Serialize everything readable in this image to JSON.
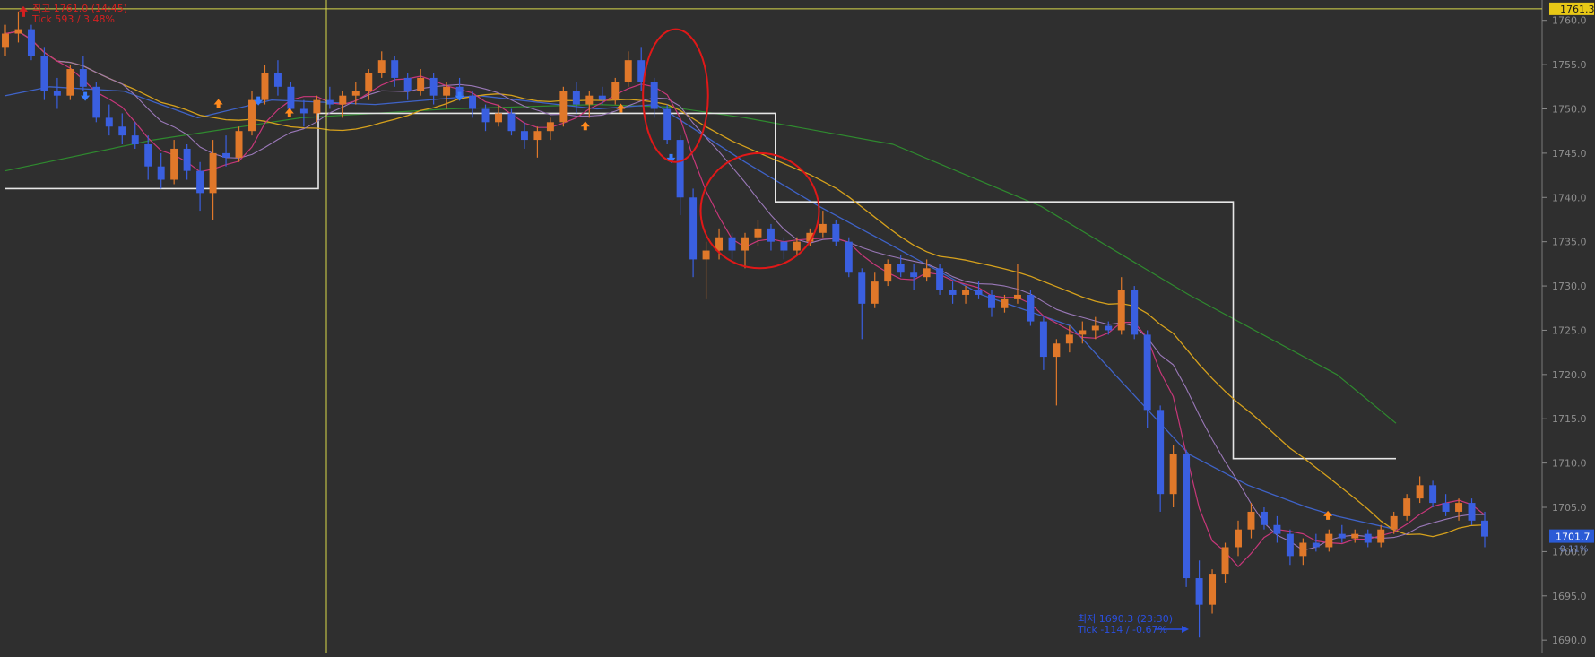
{
  "chart_data": {
    "type": "candlestick",
    "ylim": [
      1688.5,
      1762.3
    ],
    "yticks": [
      "1760.0",
      "1755.0",
      "1750.0",
      "1745.0",
      "1740.0",
      "1735.0",
      "1730.0",
      "1725.0",
      "1720.0",
      "1715.0",
      "1710.0",
      "1705.0",
      "1700.0",
      "1695.0",
      "1690.0"
    ],
    "ytick_values": [
      1760,
      1755,
      1750,
      1745,
      1740,
      1735,
      1730,
      1725,
      1720,
      1715,
      1710,
      1705,
      1700,
      1695,
      1690
    ],
    "crosshair_price_label": "1761.3",
    "crosshair_price": 1761.3,
    "last_price_label": "1701.7",
    "last_price": 1701.7,
    "last_change_label": "-0.11%",
    "high_annotation": {
      "line1": "최고 1761.0 (14:45)",
      "line2": "Tick 593 / 3.48%",
      "price": 1761.0
    },
    "low_annotation": {
      "line1": "최저 1690.3 (23:30)",
      "line2": "Tick -114 / -0.67%",
      "price": 1690.3
    },
    "candles": [
      [
        1757.0,
        1759.5,
        1756.0,
        1758.5
      ],
      [
        1758.5,
        1761.0,
        1757.5,
        1759.0
      ],
      [
        1759.0,
        1759.5,
        1755.5,
        1756.0
      ],
      [
        1756.0,
        1757.0,
        1751.0,
        1752.0
      ],
      [
        1752.0,
        1753.5,
        1750.0,
        1751.5
      ],
      [
        1751.5,
        1755.0,
        1751.0,
        1754.5
      ],
      [
        1754.5,
        1756.0,
        1752.0,
        1752.5
      ],
      [
        1752.5,
        1753.0,
        1748.5,
        1749.0
      ],
      [
        1749.0,
        1750.5,
        1747.0,
        1748.0
      ],
      [
        1748.0,
        1749.5,
        1746.0,
        1747.0
      ],
      [
        1747.0,
        1748.5,
        1745.5,
        1746.0
      ],
      [
        1746.0,
        1747.0,
        1742.0,
        1743.5
      ],
      [
        1743.5,
        1745.0,
        1741.0,
        1742.0
      ],
      [
        1742.0,
        1746.5,
        1741.5,
        1745.5
      ],
      [
        1745.5,
        1746.0,
        1742.0,
        1743.0
      ],
      [
        1743.0,
        1744.0,
        1738.5,
        1740.5
      ],
      [
        1740.5,
        1746.5,
        1737.5,
        1745.0
      ],
      [
        1745.0,
        1747.0,
        1743.5,
        1744.5
      ],
      [
        1744.5,
        1748.0,
        1744.0,
        1747.5
      ],
      [
        1747.5,
        1752.0,
        1747.0,
        1751.0
      ],
      [
        1751.0,
        1755.0,
        1750.5,
        1754.0
      ],
      [
        1754.0,
        1755.5,
        1751.5,
        1752.5
      ],
      [
        1752.5,
        1753.0,
        1749.5,
        1750.0
      ],
      [
        1750.0,
        1751.0,
        1748.0,
        1749.5
      ],
      [
        1749.5,
        1751.5,
        1748.5,
        1751.0
      ],
      [
        1751.0,
        1752.5,
        1750.0,
        1750.5
      ],
      [
        1750.5,
        1752.0,
        1749.0,
        1751.5
      ],
      [
        1751.5,
        1753.0,
        1750.5,
        1752.0
      ],
      [
        1752.0,
        1754.5,
        1751.0,
        1754.0
      ],
      [
        1754.0,
        1756.5,
        1753.5,
        1755.5
      ],
      [
        1755.5,
        1756.0,
        1752.5,
        1753.5
      ],
      [
        1753.5,
        1754.0,
        1751.0,
        1752.0
      ],
      [
        1752.0,
        1754.5,
        1751.5,
        1753.5
      ],
      [
        1753.5,
        1754.0,
        1750.5,
        1751.5
      ],
      [
        1751.5,
        1753.0,
        1750.0,
        1752.5
      ],
      [
        1752.5,
        1753.5,
        1751.0,
        1751.5
      ],
      [
        1751.5,
        1752.0,
        1749.0,
        1750.0
      ],
      [
        1750.0,
        1750.5,
        1747.5,
        1748.5
      ],
      [
        1748.5,
        1750.5,
        1748.0,
        1749.5
      ],
      [
        1749.5,
        1750.0,
        1747.0,
        1747.5
      ],
      [
        1747.5,
        1748.5,
        1745.5,
        1746.5
      ],
      [
        1746.5,
        1748.0,
        1744.5,
        1747.5
      ],
      [
        1747.5,
        1749.0,
        1746.5,
        1748.5
      ],
      [
        1748.5,
        1752.5,
        1748.0,
        1752.0
      ],
      [
        1752.0,
        1753.0,
        1749.5,
        1750.5
      ],
      [
        1750.5,
        1752.0,
        1749.0,
        1751.5
      ],
      [
        1751.5,
        1752.5,
        1750.5,
        1751.0
      ],
      [
        1751.0,
        1753.5,
        1750.5,
        1753.0
      ],
      [
        1753.0,
        1756.5,
        1752.5,
        1755.5
      ],
      [
        1755.5,
        1757.0,
        1752.0,
        1753.0
      ],
      [
        1753.0,
        1753.5,
        1749.0,
        1750.0
      ],
      [
        1750.0,
        1750.5,
        1746.0,
        1746.5
      ],
      [
        1746.5,
        1747.0,
        1738.0,
        1740.0
      ],
      [
        1740.0,
        1741.0,
        1731.0,
        1733.0
      ],
      [
        1733.0,
        1735.0,
        1728.5,
        1734.0
      ],
      [
        1734.0,
        1736.5,
        1733.0,
        1735.5
      ],
      [
        1735.5,
        1736.0,
        1733.0,
        1734.0
      ],
      [
        1734.0,
        1736.0,
        1732.0,
        1735.5
      ],
      [
        1735.5,
        1737.5,
        1734.5,
        1736.5
      ],
      [
        1736.5,
        1737.0,
        1734.0,
        1735.0
      ],
      [
        1735.0,
        1735.5,
        1733.0,
        1734.0
      ],
      [
        1734.0,
        1735.5,
        1733.5,
        1735.0
      ],
      [
        1735.0,
        1736.5,
        1734.5,
        1736.0
      ],
      [
        1736.0,
        1738.5,
        1735.5,
        1737.0
      ],
      [
        1737.0,
        1737.5,
        1734.5,
        1735.0
      ],
      [
        1735.0,
        1735.5,
        1731.0,
        1731.5
      ],
      [
        1731.5,
        1732.0,
        1724.0,
        1728.0
      ],
      [
        1728.0,
        1731.5,
        1727.5,
        1730.5
      ],
      [
        1730.5,
        1733.0,
        1730.0,
        1732.5
      ],
      [
        1732.5,
        1733.5,
        1731.0,
        1731.5
      ],
      [
        1731.5,
        1732.5,
        1729.5,
        1731.0
      ],
      [
        1731.0,
        1733.0,
        1730.5,
        1732.0
      ],
      [
        1732.0,
        1732.5,
        1729.0,
        1729.5
      ],
      [
        1729.5,
        1730.5,
        1728.0,
        1729.0
      ],
      [
        1729.0,
        1730.0,
        1728.0,
        1729.5
      ],
      [
        1729.5,
        1730.5,
        1728.5,
        1729.0
      ],
      [
        1729.0,
        1729.5,
        1726.5,
        1727.5
      ],
      [
        1727.5,
        1729.0,
        1727.0,
        1728.5
      ],
      [
        1728.5,
        1732.5,
        1728.0,
        1729.0
      ],
      [
        1729.0,
        1729.5,
        1725.5,
        1726.0
      ],
      [
        1726.0,
        1726.5,
        1720.5,
        1722.0
      ],
      [
        1722.0,
        1724.0,
        1716.5,
        1723.5
      ],
      [
        1723.5,
        1725.5,
        1722.5,
        1724.5
      ],
      [
        1724.5,
        1726.0,
        1723.5,
        1725.0
      ],
      [
        1725.0,
        1726.5,
        1724.0,
        1725.5
      ],
      [
        1725.5,
        1726.0,
        1724.5,
        1725.0
      ],
      [
        1725.0,
        1731.0,
        1724.5,
        1729.5
      ],
      [
        1729.5,
        1730.0,
        1724.0,
        1724.5
      ],
      [
        1724.5,
        1725.0,
        1714.0,
        1716.0
      ],
      [
        1716.0,
        1716.5,
        1704.5,
        1706.5
      ],
      [
        1706.5,
        1712.0,
        1705.0,
        1711.0
      ],
      [
        1711.0,
        1711.5,
        1696.0,
        1697.0
      ],
      [
        1697.0,
        1699.0,
        1690.3,
        1694.0
      ],
      [
        1694.0,
        1698.0,
        1693.0,
        1697.5
      ],
      [
        1697.5,
        1701.0,
        1696.5,
        1700.5
      ],
      [
        1700.5,
        1703.5,
        1699.5,
        1702.5
      ],
      [
        1702.5,
        1705.5,
        1701.5,
        1704.5
      ],
      [
        1704.5,
        1705.0,
        1702.5,
        1703.0
      ],
      [
        1703.0,
        1704.0,
        1701.0,
        1702.0
      ],
      [
        1702.0,
        1702.5,
        1698.5,
        1699.5
      ],
      [
        1699.5,
        1701.5,
        1698.5,
        1701.0
      ],
      [
        1701.0,
        1702.0,
        1700.0,
        1700.5
      ],
      [
        1700.5,
        1702.5,
        1700.0,
        1702.0
      ],
      [
        1702.0,
        1703.0,
        1701.0,
        1701.5
      ],
      [
        1701.5,
        1702.5,
        1701.0,
        1702.0
      ],
      [
        1702.0,
        1702.5,
        1700.5,
        1701.0
      ],
      [
        1701.0,
        1703.0,
        1700.5,
        1702.5
      ],
      [
        1702.5,
        1704.5,
        1702.0,
        1704.0
      ],
      [
        1704.0,
        1706.5,
        1703.5,
        1706.0
      ],
      [
        1706.0,
        1708.5,
        1705.5,
        1707.5
      ],
      [
        1707.5,
        1708.0,
        1705.0,
        1705.5
      ],
      [
        1705.5,
        1706.5,
        1704.0,
        1704.5
      ],
      [
        1704.5,
        1706.0,
        1703.5,
        1705.5
      ],
      [
        1705.5,
        1706.0,
        1703.0,
        1703.5
      ],
      [
        1703.5,
        1704.5,
        1700.5,
        1701.7
      ]
    ],
    "step_line": {
      "x": [
        0.0,
        0.2115,
        0.2115,
        0.5205,
        0.5205,
        0.83,
        0.83,
        0.94
      ],
      "y": [
        1741.0,
        1741.0,
        1749.5,
        1749.5,
        1739.5,
        1739.5,
        1710.5,
        1710.5
      ]
    },
    "ma_slow_green": [
      [
        0.0,
        1743.0
      ],
      [
        0.1,
        1746.5
      ],
      [
        0.2,
        1749.0
      ],
      [
        0.3,
        1750.0
      ],
      [
        0.4,
        1750.5
      ],
      [
        0.45,
        1750.2
      ],
      [
        0.5,
        1749.0
      ],
      [
        0.6,
        1746.0
      ],
      [
        0.7,
        1739.0
      ],
      [
        0.8,
        1729.0
      ],
      [
        0.9,
        1720.0
      ],
      [
        0.94,
        1714.5
      ]
    ],
    "ma_mid_blue": [
      [
        0.0,
        1751.5
      ],
      [
        0.03,
        1752.5
      ],
      [
        0.08,
        1752.0
      ],
      [
        0.13,
        1749.0
      ],
      [
        0.18,
        1751.0
      ],
      [
        0.25,
        1750.5
      ],
      [
        0.32,
        1751.5
      ],
      [
        0.4,
        1750.0
      ],
      [
        0.44,
        1750.5
      ],
      [
        0.5,
        1744.0
      ],
      [
        0.55,
        1739.0
      ],
      [
        0.6,
        1734.5
      ],
      [
        0.66,
        1729.0
      ],
      [
        0.72,
        1725.5
      ],
      [
        0.75,
        1720.0
      ],
      [
        0.8,
        1711.0
      ],
      [
        0.84,
        1707.5
      ],
      [
        0.88,
        1705.0
      ],
      [
        0.9,
        1704.0
      ],
      [
        0.94,
        1702.5
      ]
    ],
    "signals_up": [
      [
        0.144,
        1750.5
      ],
      [
        0.192,
        1749.5
      ],
      [
        0.392,
        1748.0
      ],
      [
        0.416,
        1750.0
      ],
      [
        0.894,
        1704.0
      ]
    ],
    "signals_down": [
      [
        0.054,
        1751.5
      ],
      [
        0.171,
        1751.0
      ],
      [
        0.307,
        1751.5
      ],
      [
        0.45,
        1744.5
      ]
    ],
    "circles": [
      [
        0.453,
        1751.5,
        0.022,
        7.5
      ],
      [
        0.51,
        1738.5,
        0.04,
        6.5
      ]
    ]
  }
}
